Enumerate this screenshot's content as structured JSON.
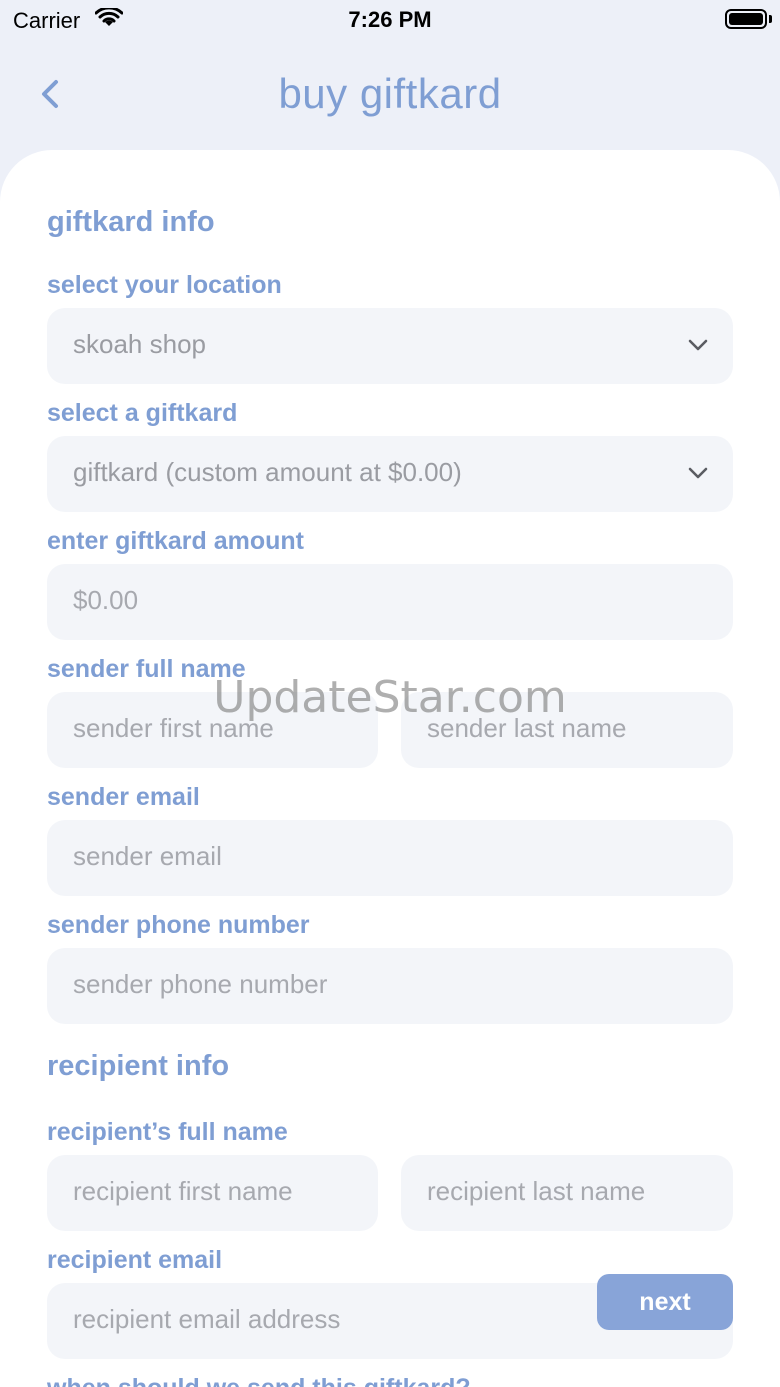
{
  "status": {
    "carrier": "Carrier",
    "time": "7:26 PM"
  },
  "nav": {
    "title": "buy giftkard",
    "back_icon": "chevron-left-icon"
  },
  "giftkard_info": {
    "section_title": "giftkard info",
    "location_label": "select your location",
    "location_value": "skoah shop",
    "giftkard_label": "select a giftkard",
    "giftkard_value": "giftkard (custom amount at $0.00)",
    "amount_label": "enter giftkard amount",
    "amount_value": "$0.00",
    "sender_name_label": "sender full name",
    "sender_first_placeholder": "sender first name",
    "sender_last_placeholder": "sender last name",
    "sender_email_label": "sender email",
    "sender_email_placeholder": "sender email",
    "sender_phone_label": "sender phone number",
    "sender_phone_placeholder": "sender phone number"
  },
  "recipient_info": {
    "section_title": "recipient info",
    "name_label": "recipient’s full name",
    "first_placeholder": "recipient first name",
    "last_placeholder": "recipient last name",
    "email_label": "recipient email",
    "email_placeholder": "recipient email address",
    "when_label": "when should we send this giftkard?"
  },
  "next_label": "next",
  "watermark": "UpdateStar.com",
  "colors": {
    "accent": "#7f9ed3",
    "button": "#88a4d8",
    "field_bg": "#f3f5f9",
    "page_bg": "#edf0f8"
  }
}
